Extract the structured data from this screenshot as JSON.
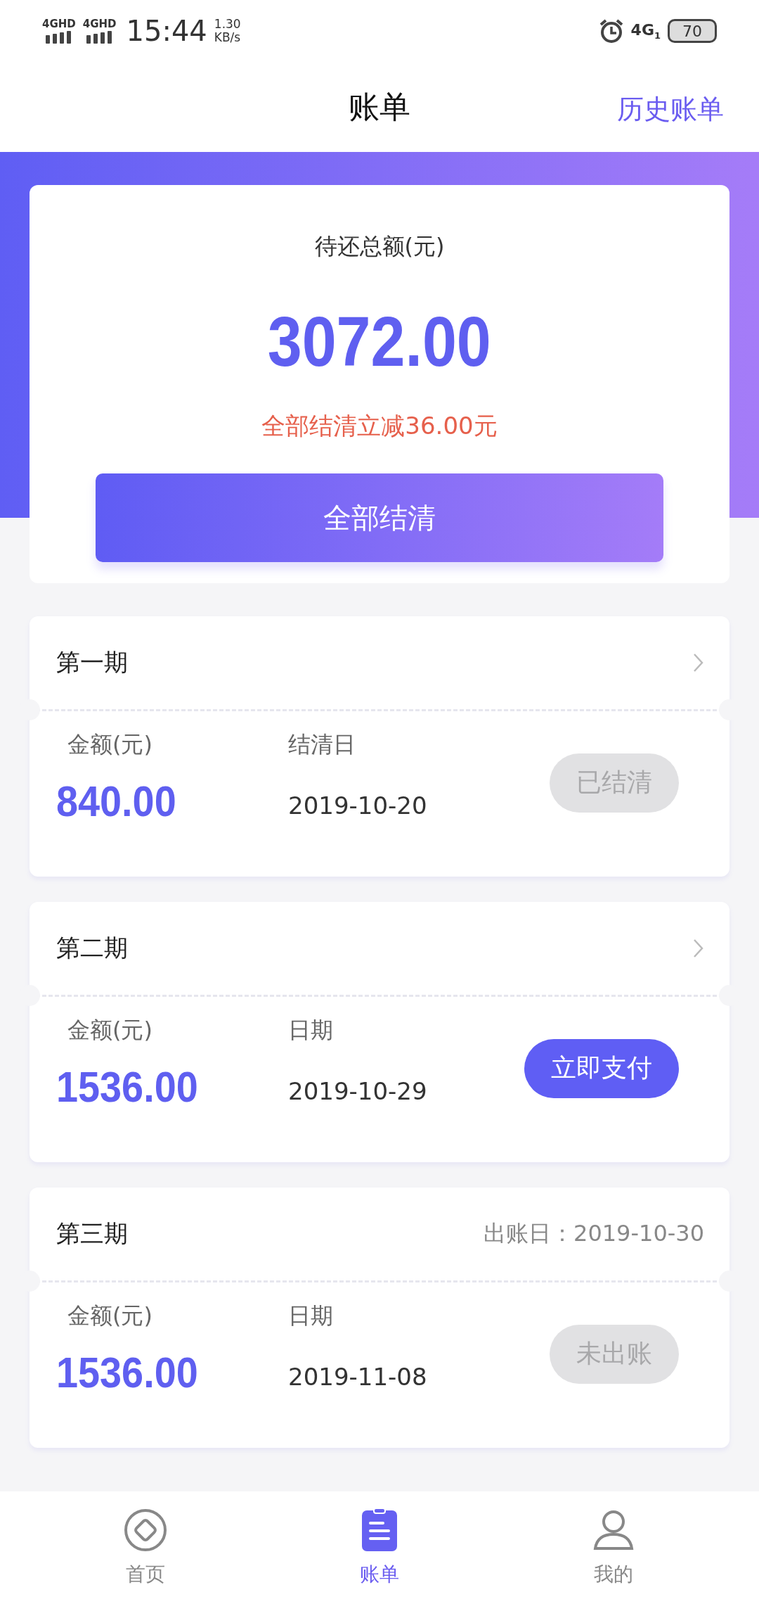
{
  "status_bar": {
    "signal_1": "4GHD",
    "signal_2": "4GHD",
    "time": "15:44",
    "speed_value": "1.30",
    "speed_unit": "KB/s",
    "network": "4G",
    "network_sub": "1",
    "battery": "70"
  },
  "header": {
    "title": "账单",
    "action": "历史账单"
  },
  "summary": {
    "label": "待还总额(元)",
    "amount": "3072.00",
    "discount": "全部结清立减36.00元",
    "button": "全部结清"
  },
  "bills": [
    {
      "title": "第一期",
      "arrow": true,
      "amount_label": "金额(元)",
      "amount": "840.00",
      "date_label": "结清日",
      "date": "2019-10-20",
      "button": {
        "label": "已结清",
        "kind": "disabled"
      }
    },
    {
      "title": "第二期",
      "arrow": true,
      "amount_label": "金额(元)",
      "amount": "1536.00",
      "date_label": "日期",
      "date": "2019-10-29",
      "button": {
        "label": "立即支付",
        "kind": "pay"
      }
    },
    {
      "title": "第三期",
      "arrow": false,
      "note": "出账日：2019-10-30",
      "amount_label": "金额(元)",
      "amount": "1536.00",
      "date_label": "日期",
      "date": "2019-11-08",
      "button": {
        "label": "未出账",
        "kind": "disabled"
      }
    }
  ],
  "tabs": [
    {
      "label": "首页",
      "selected": false
    },
    {
      "label": "账单",
      "selected": true
    },
    {
      "label": "我的",
      "selected": false
    }
  ]
}
